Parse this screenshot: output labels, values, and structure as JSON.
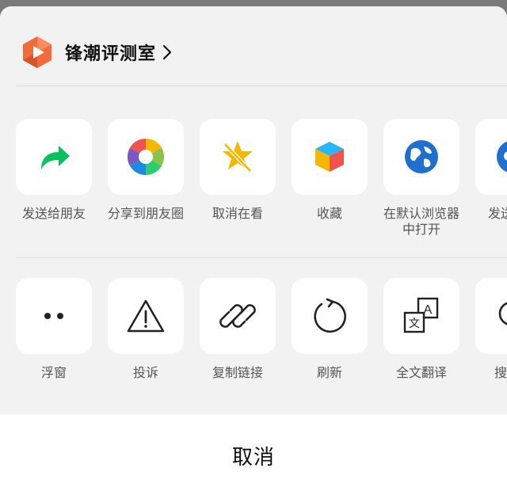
{
  "header": {
    "account_name": "锋潮评测室"
  },
  "share_row": [
    {
      "label": "发送给朋友",
      "icon": "forward-arrow-icon"
    },
    {
      "label": "分享到朋友圈",
      "icon": "moments-aperture-icon"
    },
    {
      "label": "取消在看",
      "icon": "unwow-star-icon"
    },
    {
      "label": "收藏",
      "icon": "favorites-cube-icon"
    },
    {
      "label": "在默认浏览器中打开",
      "icon": "browser-globe-icon"
    },
    {
      "label": "发送给企",
      "icon": "wecom-icon"
    }
  ],
  "action_row": [
    {
      "label": "浮窗",
      "icon": "floating-window-icon"
    },
    {
      "label": "投诉",
      "icon": "warning-triangle-icon"
    },
    {
      "label": "复制链接",
      "icon": "link-icon"
    },
    {
      "label": "刷新",
      "icon": "refresh-icon"
    },
    {
      "label": "全文翻译",
      "icon": "translate-icon"
    },
    {
      "label": "搜索页",
      "icon": "search-icon"
    }
  ],
  "cancel_label": "取消",
  "colors": {
    "forward_green": "#07c160",
    "brand_orange": "#f26b3a",
    "globe_blue": "#1f6fd1",
    "star_yellow": "#f5b800"
  }
}
